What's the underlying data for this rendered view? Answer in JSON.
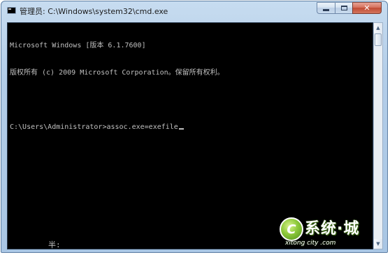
{
  "window": {
    "title": "管理员: C:\\Windows\\system32\\cmd.exe",
    "minimize_icon": "minimize-icon",
    "maximize_icon": "maximize-icon",
    "close_label": "✕"
  },
  "console": {
    "lines": [
      "Microsoft Windows [版本 6.1.7600]",
      "版权所有 (c) 2009 Microsoft Corporation。保留所有权利。",
      "",
      "C:\\Users\\Administrator>assoc.exe=exefile"
    ],
    "ime_status": "半:"
  },
  "scrollbar": {
    "up_arrow": "▲",
    "down_arrow": "▼"
  },
  "watermark": {
    "logo_letter": "C",
    "brand": "系统·城",
    "url": "xitong city .com"
  },
  "colors": {
    "console_bg": "#000000",
    "console_fg": "#c0c0c0",
    "title_bar": "#b3cde8",
    "close_button": "#c14a33",
    "watermark_green": "#8cc83a"
  }
}
